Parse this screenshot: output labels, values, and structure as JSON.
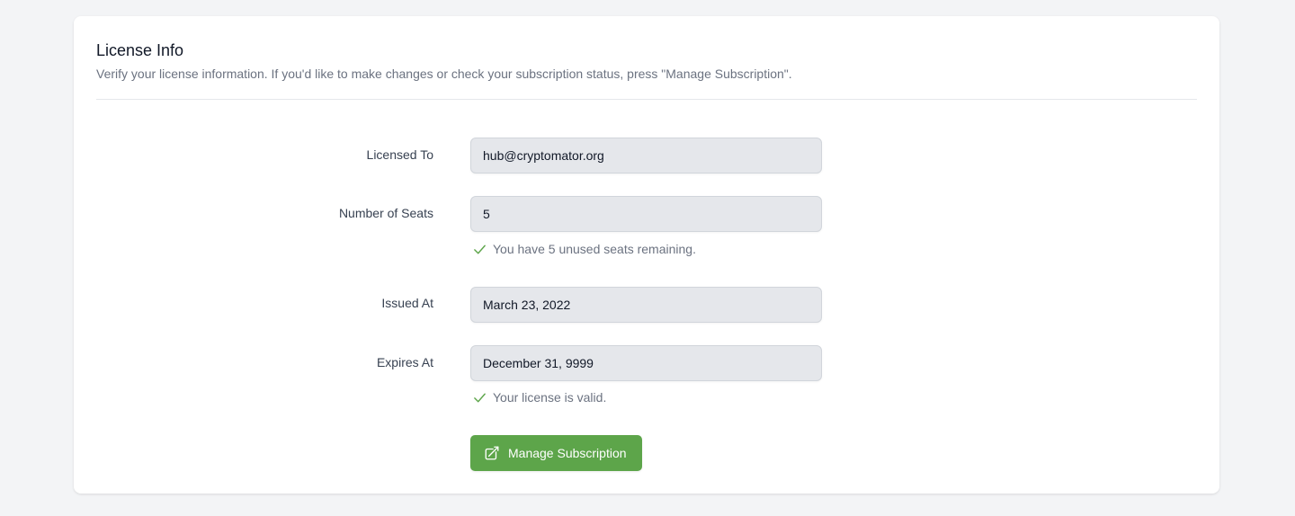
{
  "card": {
    "title": "License Info",
    "subtitle": "Verify your license information. If you'd like to make changes or check your subscription status, press \"Manage Subscription\"."
  },
  "fields": {
    "licensed_to": {
      "label": "Licensed To",
      "value": "hub@cryptomator.org"
    },
    "seats": {
      "label": "Number of Seats",
      "value": "5",
      "hint": "You have 5 unused seats remaining."
    },
    "issued_at": {
      "label": "Issued At",
      "value": "March 23, 2022"
    },
    "expires_at": {
      "label": "Expires At",
      "value": "December 31, 9999",
      "hint": "Your license is valid."
    }
  },
  "actions": {
    "manage_label": "Manage Subscription"
  },
  "colors": {
    "accent": "#5da54a",
    "success": "#5da54a",
    "background": "#f3f4f6",
    "input_bg": "#e5e7eb"
  },
  "icons": {
    "hint_icon": "check-icon",
    "manage_icon": "external-link-icon"
  }
}
